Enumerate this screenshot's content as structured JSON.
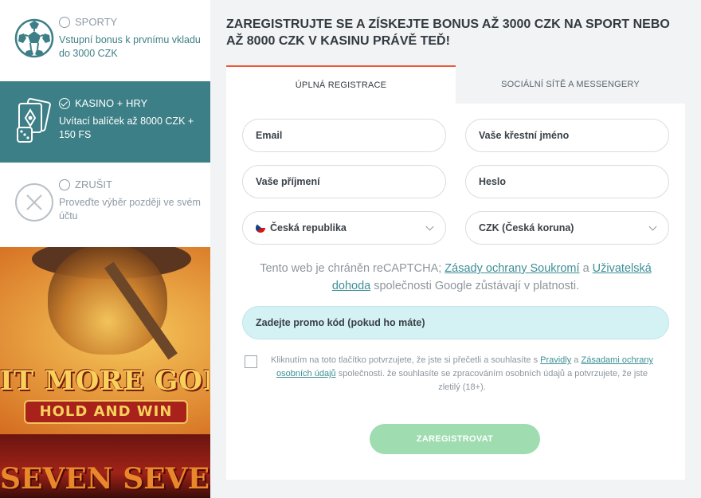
{
  "bonus": {
    "sport": {
      "title": "SPORTY",
      "desc": "Vstupní bonus k prvnímu vkladu do 3000 CZK",
      "icon": "soccer-ball-icon"
    },
    "casino": {
      "title": "KASINO + HRY",
      "desc": "Uvítací balíček až 8000 CZK + 150 FS",
      "icon": "casino-cards-dice-icon",
      "selected": true
    },
    "cancel": {
      "title": "ZRUŠIT",
      "desc": "Proveďte výběr později ve svém účtu",
      "icon": "close-circle-icon"
    }
  },
  "background": {
    "logo_line1": "IT MORE GOLD",
    "logo_line2": "HOLD AND WIN",
    "logo_line3": "SEVEN SEVEN"
  },
  "modal": {
    "title": "ZAREGISTRUJTE SE A ZÍSKEJTE BONUS AŽ 3000 CZK NA SPORT NEBO AŽ 8000 CZK V KASINU PRÁVĚ TEĎ!",
    "tabs": [
      {
        "label": "ÚPLNÁ REGISTRACE",
        "active": true
      },
      {
        "label": "SOCIÁLNÍ SÍTĚ A MESSENGERY",
        "active": false
      }
    ],
    "fields": {
      "email": "Email",
      "first_name": "Vaše křestní jméno",
      "last_name": "Vaše příjmení",
      "password": "Heslo",
      "country": "Česká republika",
      "currency": "CZK (Česká koruna)"
    },
    "recaptcha": {
      "prefix": "Tento web je chráněn reCAPTCHA; ",
      "privacy_link": "Zásady ochrany Soukromí",
      "and": " a ",
      "terms_link": "Uživatelská dohoda",
      "suffix": " společnosti Google zůstávají v platnosti."
    },
    "promo_placeholder": "Zadejte promo kód (pokud ho máte)",
    "consent": {
      "prefix": "Kliknutím na toto tlačítko potvrzujete, že jste si přečetli a souhlasíte s ",
      "rules_link": "Pravidly",
      "and": " a ",
      "privacy_link": "Zásadami ochrany osobních údajů",
      "suffix": " společnosti. že souhlasíte se zpracováním osobních údajů a potvrzujete, že jste zletilý (18+).",
      "checked": false
    },
    "submit_label": "ZAREGISTROVAT"
  },
  "colors": {
    "teal": "#3d7f86",
    "accent_tab": "#e85a3a",
    "submit_bg": "#9fdcb0",
    "promo_bg": "#d4f2f4"
  }
}
